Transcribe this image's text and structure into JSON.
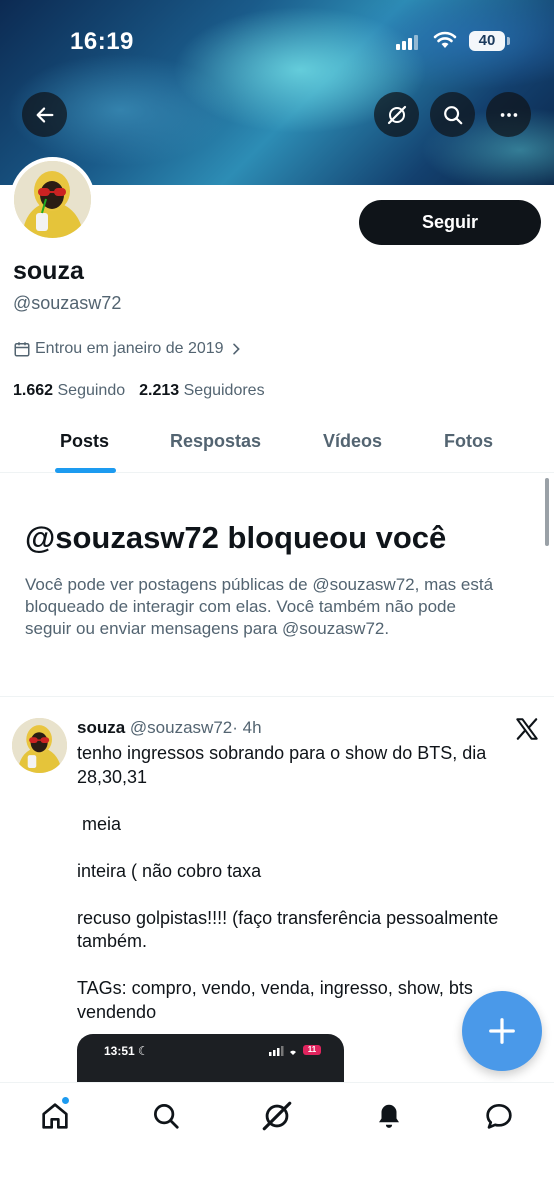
{
  "status_bar": {
    "time": "16:19",
    "battery": "40"
  },
  "header": {
    "back_icon": "arrow-left-icon",
    "grok_icon": "grok-icon",
    "search_icon": "search-icon",
    "more_icon": "more-horizontal-icon"
  },
  "profile": {
    "display_name": "souza",
    "handle": "@souzasw72",
    "follow_label": "Seguir",
    "joined": "Entrou em janeiro de 2019",
    "following_count": "1.662",
    "following_label": "Seguindo",
    "followers_count": "2.213",
    "followers_label": "Seguidores"
  },
  "tabs": [
    {
      "label": "Posts",
      "active": true
    },
    {
      "label": "Respostas",
      "active": false
    },
    {
      "label": "Vídeos",
      "active": false
    },
    {
      "label": "Fotos",
      "active": false
    }
  ],
  "blocked": {
    "title": "@souzasw72 bloqueou você",
    "text": "Você pode ver postagens públicas de @souzasw72, mas está bloqueado de interagir com elas. Você também não pode seguir ou enviar mensagens para @souzasw72."
  },
  "post": {
    "name": "souza",
    "handle": "@souzasw72",
    "time": "· 4h",
    "lines": [
      "tenho ingressos sobrando para o show do BTS, dia 28,30,31",
      "",
      " meia",
      "",
      "inteira ( não cobro taxa",
      "",
      "recuso golpistas!!!! (faço transferência pessoalmente também.",
      "",
      "TAGs: compro, vendo, venda, ingresso, show, bts vendendo"
    ],
    "media": {
      "time": "13:51",
      "battery": "11"
    }
  },
  "bottom_nav": [
    "home-icon",
    "search-icon",
    "grok-icon",
    "notifications-icon",
    "messages-icon"
  ],
  "colors": {
    "accent": "#1d9bf0",
    "fab": "#4a99e9",
    "text": "#0f1419",
    "secondary": "#536471"
  }
}
